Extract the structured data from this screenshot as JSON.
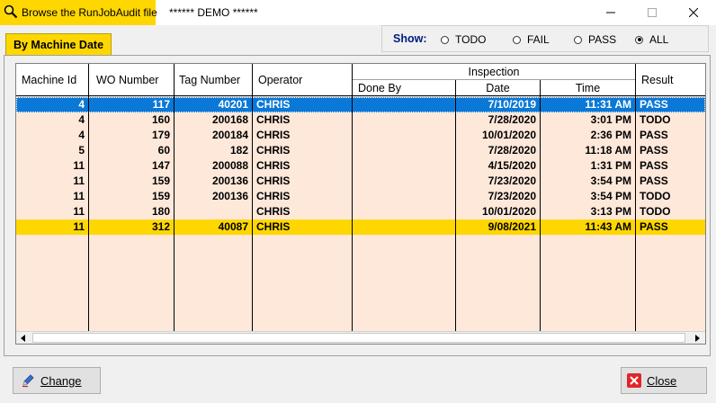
{
  "window": {
    "title": "Browse the RunJobAudit file",
    "demo": "****** DEMO ******"
  },
  "tab": {
    "label": "By Machine Date"
  },
  "filter": {
    "label": "Show:",
    "options": [
      "TODO",
      "FAIL",
      "PASS",
      "ALL"
    ],
    "selected": "ALL"
  },
  "table": {
    "headers": {
      "machine_id": "Machine Id",
      "wo_number": "WO Number",
      "tag_number": "Tag Number",
      "operator": "Operator",
      "inspection": "Inspection",
      "done_by": "Done By",
      "date": "Date",
      "time": "Time",
      "result": "Result"
    },
    "rows": [
      {
        "machine_id": "4",
        "wo_number": "117",
        "tag_number": "40201",
        "operator": "CHRIS",
        "done_by": "",
        "date": "7/10/2019",
        "time": "11:31 AM",
        "result": "PASS",
        "state": "selected"
      },
      {
        "machine_id": "4",
        "wo_number": "160",
        "tag_number": "200168",
        "operator": "CHRIS",
        "done_by": "",
        "date": "7/28/2020",
        "time": "3:01 PM",
        "result": "TODO",
        "state": ""
      },
      {
        "machine_id": "4",
        "wo_number": "179",
        "tag_number": "200184",
        "operator": "CHRIS",
        "done_by": "",
        "date": "10/01/2020",
        "time": "2:36 PM",
        "result": "PASS",
        "state": ""
      },
      {
        "machine_id": "5",
        "wo_number": "60",
        "tag_number": "182",
        "operator": "CHRIS",
        "done_by": "",
        "date": "7/28/2020",
        "time": "11:18 AM",
        "result": "PASS",
        "state": ""
      },
      {
        "machine_id": "11",
        "wo_number": "147",
        "tag_number": "200088",
        "operator": "CHRIS",
        "done_by": "",
        "date": "4/15/2020",
        "time": "1:31 PM",
        "result": "PASS",
        "state": ""
      },
      {
        "machine_id": "11",
        "wo_number": "159",
        "tag_number": "200136",
        "operator": "CHRIS",
        "done_by": "",
        "date": "7/23/2020",
        "time": "3:54 PM",
        "result": "PASS",
        "state": ""
      },
      {
        "machine_id": "11",
        "wo_number": "159",
        "tag_number": "200136",
        "operator": "CHRIS",
        "done_by": "",
        "date": "7/23/2020",
        "time": "3:54 PM",
        "result": "TODO",
        "state": ""
      },
      {
        "machine_id": "11",
        "wo_number": "180",
        "tag_number": "",
        "operator": "CHRIS",
        "done_by": "",
        "date": "10/01/2020",
        "time": "3:13 PM",
        "result": "TODO",
        "state": ""
      },
      {
        "machine_id": "11",
        "wo_number": "312",
        "tag_number": "40087",
        "operator": "CHRIS",
        "done_by": "",
        "date": "9/08/2021",
        "time": "11:43 AM",
        "result": "PASS",
        "state": "highlight"
      }
    ]
  },
  "buttons": {
    "change": "Change",
    "close": "Close"
  },
  "colors": {
    "accent": "#ffd700",
    "grid_bg": "#fde8da",
    "selection": "#0a78d7",
    "show_label": "#001a80"
  }
}
